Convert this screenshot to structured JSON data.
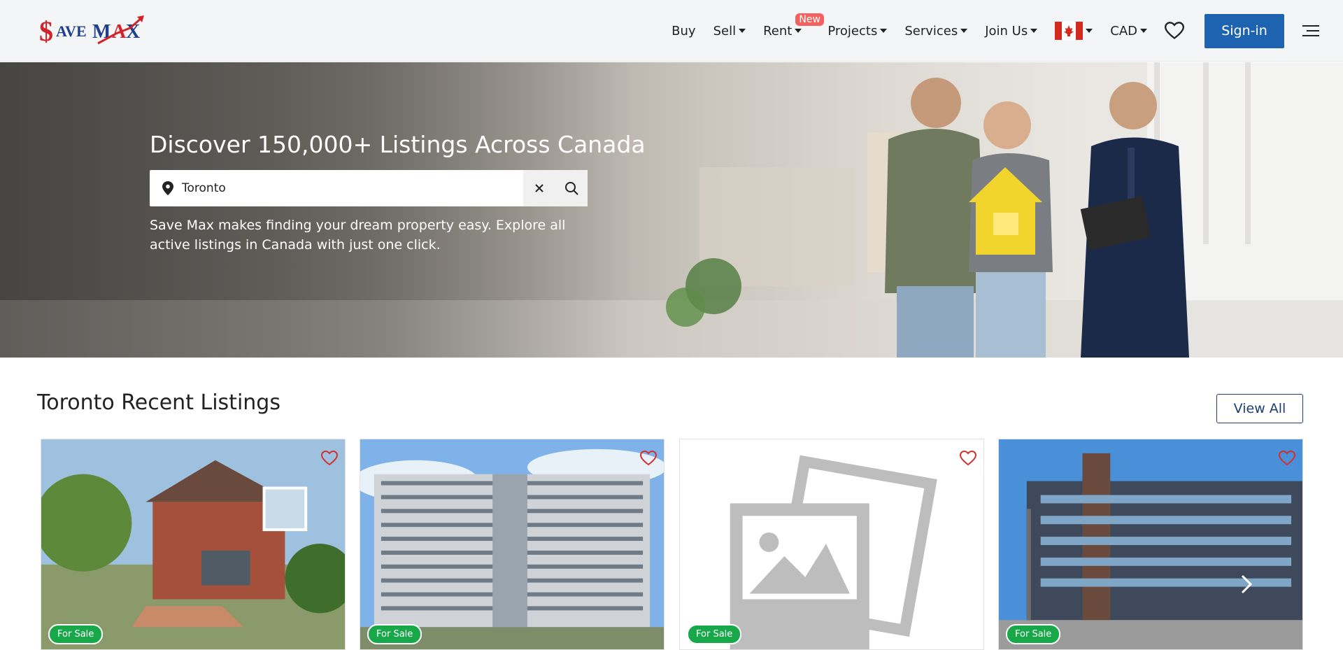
{
  "header": {
    "logo_text": "$AVE MAX",
    "nav": [
      {
        "label": "Buy"
      },
      {
        "label": "Sell"
      },
      {
        "label": "Rent"
      },
      {
        "label": "Projects",
        "badge": "New"
      },
      {
        "label": "Services"
      },
      {
        "label": "Join Us"
      },
      {
        "label": "CAD"
      }
    ],
    "signin_label": "Sign-in",
    "colors": {
      "signin_bg": "#1e63b0",
      "badge_bg": "#f26060"
    }
  },
  "hero": {
    "title": "Discover 150,000+ Listings Across Canada",
    "search": {
      "value": "Toronto",
      "placeholder": ""
    },
    "subtitle": "Save Max makes finding your dream property easy. Explore all active listings in Canada with just one click."
  },
  "listings": {
    "title": "Toronto Recent Listings",
    "view_all_label": "View All",
    "cards": [
      {
        "badge": "For Sale",
        "image": "brick-house"
      },
      {
        "badge": "For Sale",
        "image": "apartment-tower"
      },
      {
        "badge": "For Sale",
        "image": "placeholder-image-icon"
      },
      {
        "badge": "For Sale",
        "image": "modern-condo"
      }
    ],
    "colors": {
      "badge_bg": "#18a84a",
      "fav": "#d32f2f"
    }
  }
}
